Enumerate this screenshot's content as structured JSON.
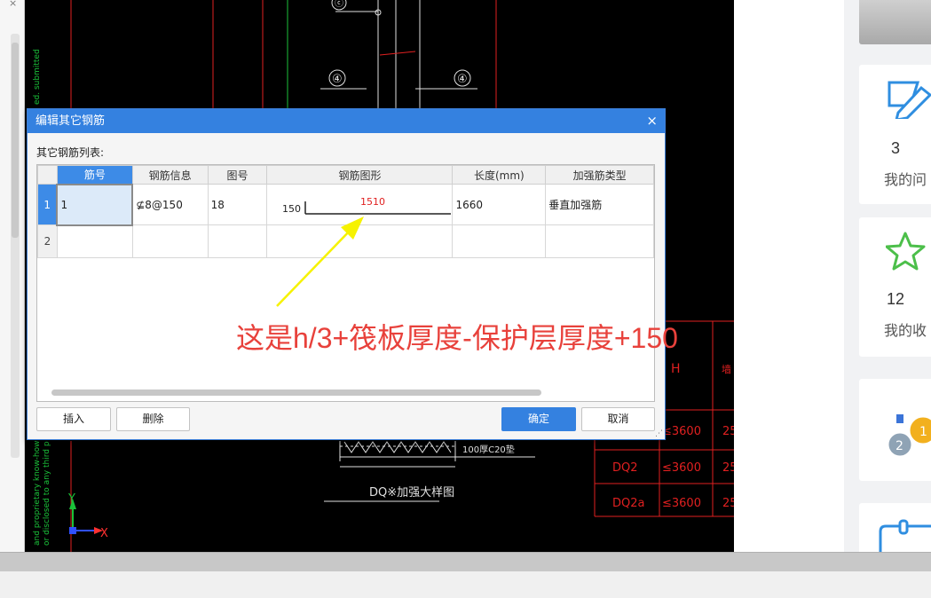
{
  "left_panel": {
    "close_glyph": "×"
  },
  "cad": {
    "axis_markers": [
      "④",
      "④",
      "ⓒ"
    ],
    "side_text": [
      "ed. submitted",
      "and proprietary know-how c",
      "or disclosed to any third p"
    ],
    "y_axis": "Y",
    "x_axis": "X",
    "detail_label": "DQ※加强大样图",
    "note_text": "100厚C20垫",
    "table": {
      "headers": [
        "H",
        "墙"
      ],
      "rows": [
        [
          "",
          "≤3600",
          "25"
        ],
        [
          "DQ2",
          "≤3600",
          "25"
        ],
        [
          "DQ2a",
          "≤3600",
          "25"
        ]
      ]
    }
  },
  "dialog": {
    "title": "编辑其它钢筋",
    "close_glyph": "×",
    "list_label": "其它钢筋列表:",
    "columns": [
      "筋号",
      "钢筋信息",
      "图号",
      "钢筋图形",
      "长度(mm)",
      "加强筋类型"
    ],
    "rows": [
      {
        "index": "1",
        "bar_no": "1",
        "info": "⊈8@150",
        "figure_no": "18",
        "shape_left": "150",
        "shape_value": "1510",
        "length": "1660",
        "type": "垂直加强筋"
      },
      {
        "index": "2",
        "bar_no": "",
        "info": "",
        "figure_no": "",
        "shape_left": "",
        "shape_value": "",
        "length": "",
        "type": ""
      }
    ],
    "buttons": {
      "insert": "插入",
      "delete": "删除",
      "ok": "确定",
      "cancel": "取消"
    }
  },
  "annotation": {
    "text": "这是h/3+筏板厚度-保护层厚度+150",
    "color": "#e8413b"
  },
  "right_panel": {
    "cards": [
      {
        "count": "3",
        "label": "我的问"
      },
      {
        "count": "12",
        "label": "我的收"
      }
    ]
  }
}
